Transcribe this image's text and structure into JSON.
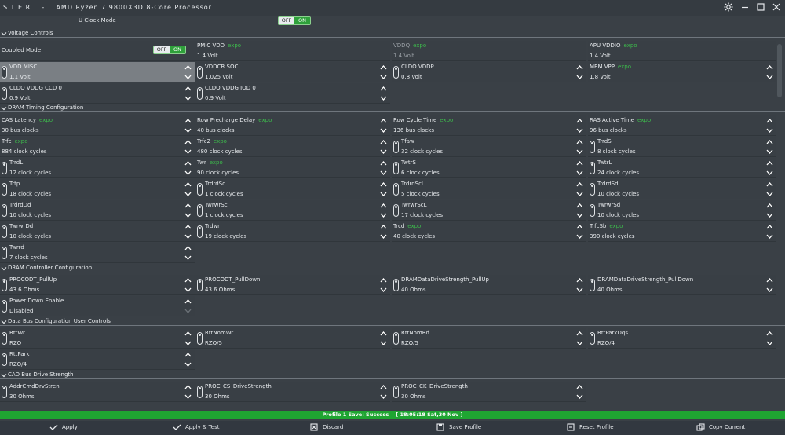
{
  "app": {
    "title": "S T E R    -    AMD Ryzen 7 9800X3D 8-Core Processor"
  },
  "uclock": {
    "label": "U Clock Mode",
    "off": "OFF",
    "on": "ON"
  },
  "coupled": {
    "label": "Coupled Mode",
    "off": "OFF",
    "on": "ON"
  },
  "sections": {
    "voltage": "Voltage Controls",
    "dram_timing": "DRAM Timing Configuration",
    "dram_controller": "DRAM Controller Configuration",
    "data_bus": "Data Bus Configuration User Controls",
    "cad_bus": "CAD Bus Drive Strength"
  },
  "expo_tag": "expo",
  "voltage": {
    "pmic_vdd": {
      "label": "PMIC VDD",
      "value": "1.4  Volt",
      "expo": true
    },
    "vddq": {
      "label": "VDDQ",
      "value": "1.4  Volt",
      "expo": true
    },
    "apu_vddio": {
      "label": "APU VDDIO",
      "value": "1.4  Volt",
      "expo": true
    },
    "vdd_misc": {
      "label": "VDD MISC",
      "value": "1.1  Volt"
    },
    "vddcr_soc": {
      "label": "VDDCR SOC",
      "value": "1.025  Volt"
    },
    "cldo_vddp": {
      "label": "CLDO VDDP",
      "value": "0.8  Volt"
    },
    "mem_vpp": {
      "label": "MEM VPP",
      "value": "1.8  Volt",
      "expo": true
    },
    "cldo_ccd0": {
      "label": "CLDO VDDG CCD 0",
      "value": "0.9  Volt"
    },
    "cldo_iod0": {
      "label": "CLDO VDDG IOD 0",
      "value": "0.9  Volt"
    }
  },
  "timing": {
    "cas": {
      "label": "CAS Latency",
      "value": "30  bus clocks",
      "expo": true
    },
    "trp": {
      "label": "Row Precharge Delay",
      "value": "40  bus clocks",
      "expo": true
    },
    "trc": {
      "label": "Row Cycle Time",
      "value": "136  bus clocks",
      "expo": true
    },
    "tras": {
      "label": "RAS Active Time",
      "value": "96  bus clocks",
      "expo": true
    },
    "trfc": {
      "label": "Trfc",
      "value": "884  clock cycles",
      "expo": true
    },
    "trfc2": {
      "label": "Trfc2",
      "value": "480  clock cycles",
      "expo": true
    },
    "tfaw": {
      "label": "Tfaw",
      "value": "32  clock cycles"
    },
    "trrds": {
      "label": "TrrdS",
      "value": "8  clock cycles"
    },
    "trrdl": {
      "label": "TrrdL",
      "value": "12  clock cycles"
    },
    "twr": {
      "label": "Twr",
      "value": "90  clock cycles",
      "expo": true
    },
    "twtrs": {
      "label": "TwtrS",
      "value": "6  clock cycles"
    },
    "twtrl": {
      "label": "TwtrL",
      "value": "24  clock cycles"
    },
    "trtp": {
      "label": "Trtp",
      "value": "18  clock cycles"
    },
    "trdrdsc": {
      "label": "TrdrdSc",
      "value": "1  clock cycles"
    },
    "trdrdscl": {
      "label": "TrdrdScL",
      "value": "5  clock cycles"
    },
    "trdrdsd": {
      "label": "TrdrdSd",
      "value": "10  clock cycles"
    },
    "trdrddd": {
      "label": "TrdrdDd",
      "value": "10  clock cycles"
    },
    "twrwrsc": {
      "label": "TwrwrSc",
      "value": "1  clock cycles"
    },
    "twrwrscl": {
      "label": "TwrwrScL",
      "value": "17  clock cycles"
    },
    "twrwrsd": {
      "label": "TwrwrSd",
      "value": "10  clock cycles"
    },
    "twrwrdd": {
      "label": "TwrwrDd",
      "value": "10  clock cycles"
    },
    "trdwr": {
      "label": "Trdwr",
      "value": "19  clock cycles"
    },
    "trcd": {
      "label": "Trcd",
      "value": "40  clock cycles",
      "expo": true
    },
    "trfcsb": {
      "label": "TrfcSb",
      "value": "390  clock cycles",
      "expo": true
    },
    "twrrd": {
      "label": "Twrrd",
      "value": "7  clock cycles"
    }
  },
  "controller": {
    "procodt_pu": {
      "label": "PROCODT_PullUp",
      "value": "43.6 Ohms"
    },
    "procodt_pd": {
      "label": "PROCODT_PullDown",
      "value": "43.6 Ohms"
    },
    "dram_ds_pu": {
      "label": "DRAMDataDriveStrength_PullUp",
      "value": "40 Ohms"
    },
    "dram_ds_pd": {
      "label": "DRAMDataDriveStrength_PullDown",
      "value": "40 Ohms"
    },
    "power_down": {
      "label": "Power Down Enable",
      "value": "Disabled"
    }
  },
  "databus": {
    "rttwr": {
      "label": "RttWr",
      "value": "RZQ"
    },
    "rttnomwr": {
      "label": "RttNomWr",
      "value": "RZQ/5"
    },
    "rttnomrd": {
      "label": "RttNomRd",
      "value": "RZQ/5"
    },
    "rttparkdqs": {
      "label": "RttParkDqs",
      "value": "RZQ/4"
    },
    "rttpark": {
      "label": "RttPark",
      "value": "RZQ/4"
    }
  },
  "cadbus": {
    "addrcmd": {
      "label": "AddrCmdDrvStren",
      "value": "30 Ohms"
    },
    "proc_cs": {
      "label": "PROC_CS_DriveStrength",
      "value": "30 Ohms"
    },
    "proc_ck": {
      "label": "PROC_CK_DriveStrength",
      "value": "30 Ohms"
    }
  },
  "status": {
    "text": "Profile 1 Save: Success    [ 18:05:18 Sat,30 Nov ]"
  },
  "actions": {
    "apply": "Apply",
    "apply_test": "Apply & Test",
    "discard": "Discard",
    "save_profile": "Save Profile",
    "reset_profile": "Reset Profile",
    "copy_current": "Copy Current"
  },
  "colors": {
    "accent_green": "#2fa13b",
    "expo_green": "#3dba4c",
    "status_green": "#1fa532",
    "background": "#3a4046"
  }
}
